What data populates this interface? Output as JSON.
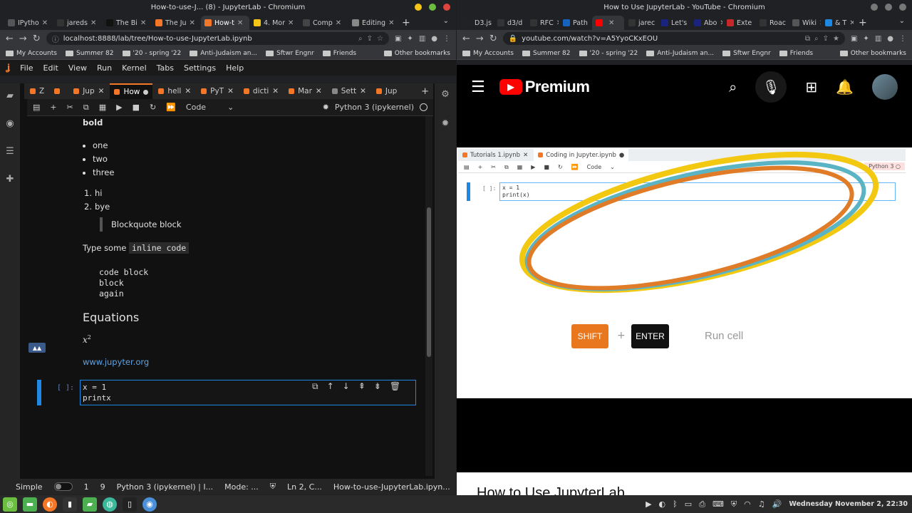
{
  "left_window": {
    "title": "How-to-use-J... (8) - JupyterLab - Chromium",
    "tabs": [
      {
        "label": "IPytho",
        "color": "#555555"
      },
      {
        "label": "jareds",
        "color": "#333333"
      },
      {
        "label": "The Bi",
        "color": "#111111"
      },
      {
        "label": "The Ju",
        "color": "#f37726"
      },
      {
        "label": "How-t",
        "color": "#f37726",
        "active": true
      },
      {
        "label": "4. Mor",
        "color": "#f5c518"
      },
      {
        "label": "Comp",
        "color": "#444444"
      },
      {
        "label": "Editing",
        "color": "#888888"
      }
    ],
    "url": "localhost:8888/lab/tree/How-to-use-JupyterLab.ipynb",
    "bookmarks": [
      "My Accounts",
      "Summer 82",
      "'20 - spring '22",
      "Anti-Judaism an...",
      "Sftwr Engnr",
      "Friends"
    ],
    "other_bookmarks": "Other bookmarks",
    "menu": [
      "File",
      "Edit",
      "View",
      "Run",
      "Kernel",
      "Tabs",
      "Settings",
      "Help"
    ],
    "doc_tabs": [
      "Z",
      "",
      "Jup",
      "How",
      "hell",
      "PyT",
      "dicti",
      "Mar",
      "Sett",
      "Jup"
    ],
    "cell_type": "Code",
    "kernel": "Python 3 (ipykernel)",
    "notebook": {
      "bold": "bold",
      "bullets": [
        "one",
        "two",
        "three"
      ],
      "numbered": [
        {
          "n": "1.",
          "text": "hi"
        },
        {
          "n": "2.",
          "text": "bye"
        }
      ],
      "blockquote": "Blockquote block",
      "inline_prefix": "Type some",
      "inline_code": "inline code",
      "code_block": "code block\nblock\nagain",
      "equations_heading": "Equations",
      "equation_base": "x",
      "equation_exp": "2",
      "link": "www.jupyter.org",
      "cell_prompt": "[ ]:",
      "cell_line1": "x = 1",
      "cell_line2": "printx "
    },
    "status": {
      "mode_label": "Simple",
      "count1": "1",
      "count2": "9",
      "kernel": "Python 3 (ipykernel) | I...",
      "mode": "Mode: ...",
      "position": "Ln 2, C...",
      "file": "How-to-use-JupyterLab.ipyn..."
    }
  },
  "right_window": {
    "title": "How to Use JupyterLab - YouTube - Chromium",
    "tabs": [
      {
        "label": "D3.js",
        "color": "#222222"
      },
      {
        "label": "d3/d",
        "color": "#333333"
      },
      {
        "label": "RFC",
        "color": "#333333"
      },
      {
        "label": "Path",
        "color": "#1565c0"
      },
      {
        "label": "",
        "color": "#ff0000",
        "active": true
      },
      {
        "label": "jarec",
        "color": "#333333"
      },
      {
        "label": "Let's",
        "color": "#1a237e"
      },
      {
        "label": "Abo",
        "color": "#1a237e"
      },
      {
        "label": "Exte",
        "color": "#c62828"
      },
      {
        "label": "Roac",
        "color": "#333333"
      },
      {
        "label": "Wiki",
        "color": "#555555"
      },
      {
        "label": "& T",
        "color": "#1e88e5"
      }
    ],
    "url": "youtube.com/watch?v=A5YyoCKxEOU",
    "bookmarks": [
      "My Accounts",
      "Summer 82",
      "'20 - spring '22",
      "Anti-Judaism an...",
      "Sftwr Engnr",
      "Friends"
    ],
    "other_bookmarks": "Other bookmarks",
    "yt_brand": "Premium",
    "video": {
      "tab1": "Tutorials 1.ipynb",
      "tab2": "Coding in Jupyter.ipynb",
      "cell_type": "Code",
      "kernel": "Python 3",
      "prompt": "[ ]:",
      "code": "x = 1\nprint(x)",
      "key1": "SHIFT",
      "plus": "+",
      "key2": "ENTER",
      "caption": "Run cell"
    },
    "video_title": "How to Use JupyterLab"
  },
  "taskbar": {
    "clock": "Wednesday November 2, 22:30"
  },
  "colors": {
    "jupyter_orange": "#f37726",
    "cell_blue": "#1e88e5",
    "yt_red": "#ff0000",
    "shift_orange": "#e8771e"
  }
}
